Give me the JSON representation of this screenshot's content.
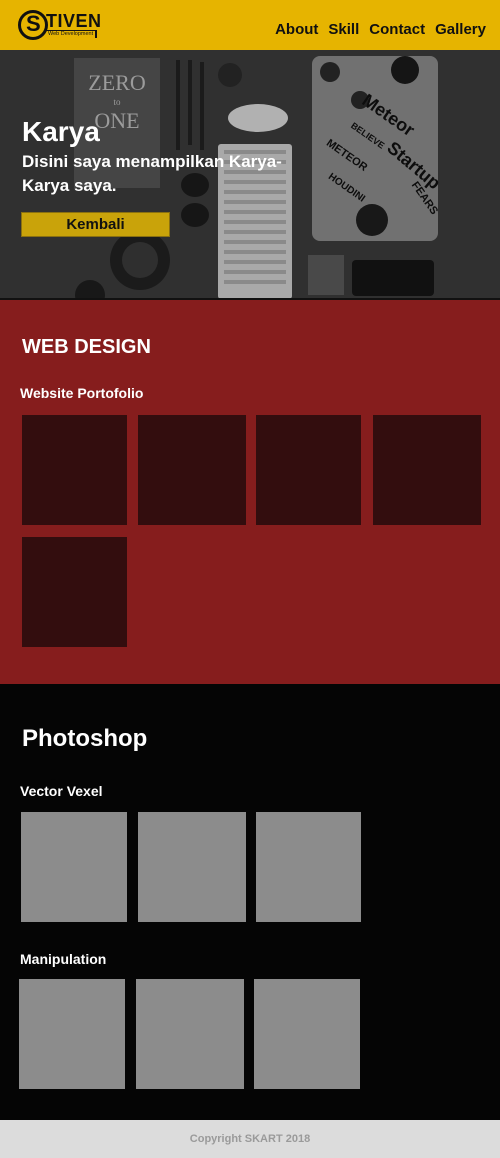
{
  "header": {
    "logo": {
      "initial": "S",
      "word": "TIVEN",
      "tagline": "Web Development"
    },
    "nav": [
      "About",
      "Skill",
      "Contact",
      "Gallery"
    ]
  },
  "hero": {
    "title": "Karya",
    "subtitle": "Disini saya menampilkan Karya-Karya saya.",
    "button": "Kembali",
    "book_text": {
      "line1": "ZERO",
      "line2": "to",
      "line3": "ONE"
    },
    "stickers": [
      "Meteor",
      "Startup",
      "METEOR",
      "HOUDINI",
      "FEARS",
      "BELIEVE"
    ]
  },
  "webdesign": {
    "title": "WEB DESIGN",
    "subtitle": "Website Portofolio",
    "tiles": 5,
    "tile_color": "#330d0e",
    "bg_color": "#861d1d"
  },
  "photoshop": {
    "title": "Photoshop",
    "groups": [
      {
        "label": "Vector Vexel",
        "tiles": 3
      },
      {
        "label": "Manipulation",
        "tiles": 3
      }
    ],
    "tile_color": "#8c8c8c"
  },
  "footer": {
    "text": "Copyright SKART 2018"
  },
  "colors": {
    "header": "#e6b400",
    "button": "#c9a30a"
  }
}
